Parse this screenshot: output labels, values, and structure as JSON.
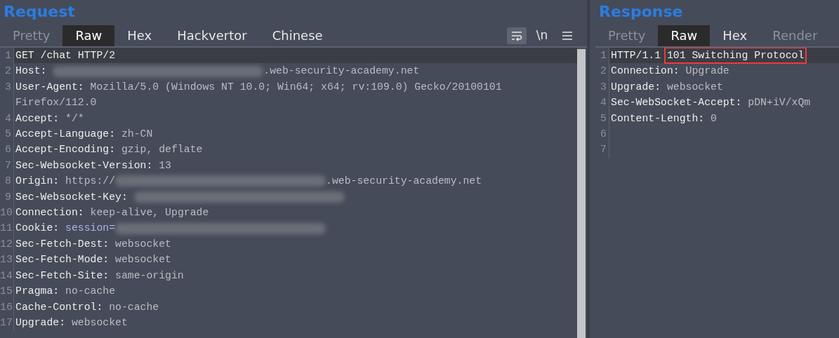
{
  "request": {
    "title": "Request",
    "tabs": [
      {
        "label": "Pretty",
        "selected": false,
        "disabled": true
      },
      {
        "label": "Raw",
        "selected": true,
        "disabled": false
      },
      {
        "label": "Hex",
        "selected": false,
        "disabled": false
      },
      {
        "label": "Hackvertor",
        "selected": false,
        "disabled": false
      },
      {
        "label": "Chinese",
        "selected": false,
        "disabled": false
      }
    ],
    "toolbar": [
      {
        "kind": "wrap",
        "pressed": true
      },
      {
        "kind": "text",
        "text": "\\n",
        "pressed": false
      },
      {
        "kind": "menu",
        "pressed": false
      }
    ],
    "lines": [
      {
        "number": "1",
        "current": true,
        "parts": [
          {
            "kind": "plain",
            "text": "GET /chat HTTP/2"
          }
        ]
      },
      {
        "number": "2",
        "current": false,
        "parts": [
          {
            "kind": "name",
            "text": "Host: "
          },
          {
            "kind": "redacted"
          },
          {
            "kind": "value",
            "text": ".web-security-academy.net"
          }
        ]
      },
      {
        "number": "3",
        "current": false,
        "parts": [
          {
            "kind": "name",
            "text": "User-Agent: "
          },
          {
            "kind": "value",
            "text": "Mozilla/5.0 (Windows NT 10.0; Win64; x64; rv:109.0) Gecko/20100101 Firefox/112.0"
          }
        ]
      },
      {
        "number": "4",
        "current": false,
        "parts": [
          {
            "kind": "name",
            "text": "Accept: "
          },
          {
            "kind": "value",
            "text": "*/*"
          }
        ]
      },
      {
        "number": "5",
        "current": false,
        "parts": [
          {
            "kind": "name",
            "text": "Accept-Language: "
          },
          {
            "kind": "value",
            "text": "zh-CN"
          }
        ]
      },
      {
        "number": "6",
        "current": false,
        "parts": [
          {
            "kind": "name",
            "text": "Accept-Encoding: "
          },
          {
            "kind": "value",
            "text": "gzip, deflate"
          }
        ]
      },
      {
        "number": "7",
        "current": false,
        "parts": [
          {
            "kind": "name",
            "text": "Sec-Websocket-Version: "
          },
          {
            "kind": "value",
            "text": "13"
          }
        ]
      },
      {
        "number": "8",
        "current": false,
        "parts": [
          {
            "kind": "name",
            "text": "Origin: "
          },
          {
            "kind": "value",
            "text": "https://"
          },
          {
            "kind": "redacted"
          },
          {
            "kind": "value",
            "text": ".web-security-academy.net"
          }
        ]
      },
      {
        "number": "9",
        "current": false,
        "parts": [
          {
            "kind": "name",
            "text": "Sec-Websocket-Key: "
          },
          {
            "kind": "redacted"
          }
        ]
      },
      {
        "number": "10",
        "current": false,
        "parts": [
          {
            "kind": "name",
            "text": "Connection: "
          },
          {
            "kind": "value",
            "text": "keep-alive, Upgrade"
          }
        ]
      },
      {
        "number": "11",
        "current": false,
        "parts": [
          {
            "kind": "name",
            "text": "Cookie: "
          },
          {
            "kind": "cookie",
            "text": "session="
          },
          {
            "kind": "redacted"
          }
        ]
      },
      {
        "number": "12",
        "current": false,
        "parts": [
          {
            "kind": "name",
            "text": "Sec-Fetch-Dest: "
          },
          {
            "kind": "value",
            "text": "websocket"
          }
        ]
      },
      {
        "number": "13",
        "current": false,
        "parts": [
          {
            "kind": "name",
            "text": "Sec-Fetch-Mode: "
          },
          {
            "kind": "value",
            "text": "websocket"
          }
        ]
      },
      {
        "number": "14",
        "current": false,
        "parts": [
          {
            "kind": "name",
            "text": "Sec-Fetch-Site: "
          },
          {
            "kind": "value",
            "text": "same-origin"
          }
        ]
      },
      {
        "number": "15",
        "current": false,
        "parts": [
          {
            "kind": "name",
            "text": "Pragma: "
          },
          {
            "kind": "value",
            "text": "no-cache"
          }
        ]
      },
      {
        "number": "16",
        "current": false,
        "parts": [
          {
            "kind": "name",
            "text": "Cache-Control: "
          },
          {
            "kind": "value",
            "text": "no-cache"
          }
        ]
      },
      {
        "number": "17",
        "current": false,
        "parts": [
          {
            "kind": "name",
            "text": "Upgrade: "
          },
          {
            "kind": "value",
            "text": "websocket"
          }
        ]
      }
    ]
  },
  "response": {
    "title": "Response",
    "tabs": [
      {
        "label": "Pretty",
        "selected": false,
        "disabled": true
      },
      {
        "label": "Raw",
        "selected": true,
        "disabled": false
      },
      {
        "label": "Hex",
        "selected": false,
        "disabled": false
      },
      {
        "label": "Render",
        "selected": false,
        "disabled": true
      }
    ],
    "lines": [
      {
        "number": "1",
        "current": true,
        "parts": [
          {
            "kind": "plain",
            "text": "HTTP/1.1 "
          },
          {
            "kind": "plain",
            "text": "101 Switching Protocol",
            "boxed": true
          }
        ]
      },
      {
        "number": "2",
        "current": false,
        "parts": [
          {
            "kind": "name",
            "text": "Connection: "
          },
          {
            "kind": "value",
            "text": "Upgrade"
          }
        ]
      },
      {
        "number": "3",
        "current": false,
        "parts": [
          {
            "kind": "name",
            "text": "Upgrade: "
          },
          {
            "kind": "value",
            "text": "websocket"
          }
        ]
      },
      {
        "number": "4",
        "current": false,
        "parts": [
          {
            "kind": "name",
            "text": "Sec-WebSocket-Accept: "
          },
          {
            "kind": "value",
            "text": "pDN+iV/xQm"
          }
        ]
      },
      {
        "number": "5",
        "current": false,
        "parts": [
          {
            "kind": "name",
            "text": "Content-Length: "
          },
          {
            "kind": "value",
            "text": "0"
          }
        ]
      },
      {
        "number": "6",
        "current": false
      },
      {
        "number": "7",
        "current": false
      }
    ]
  }
}
